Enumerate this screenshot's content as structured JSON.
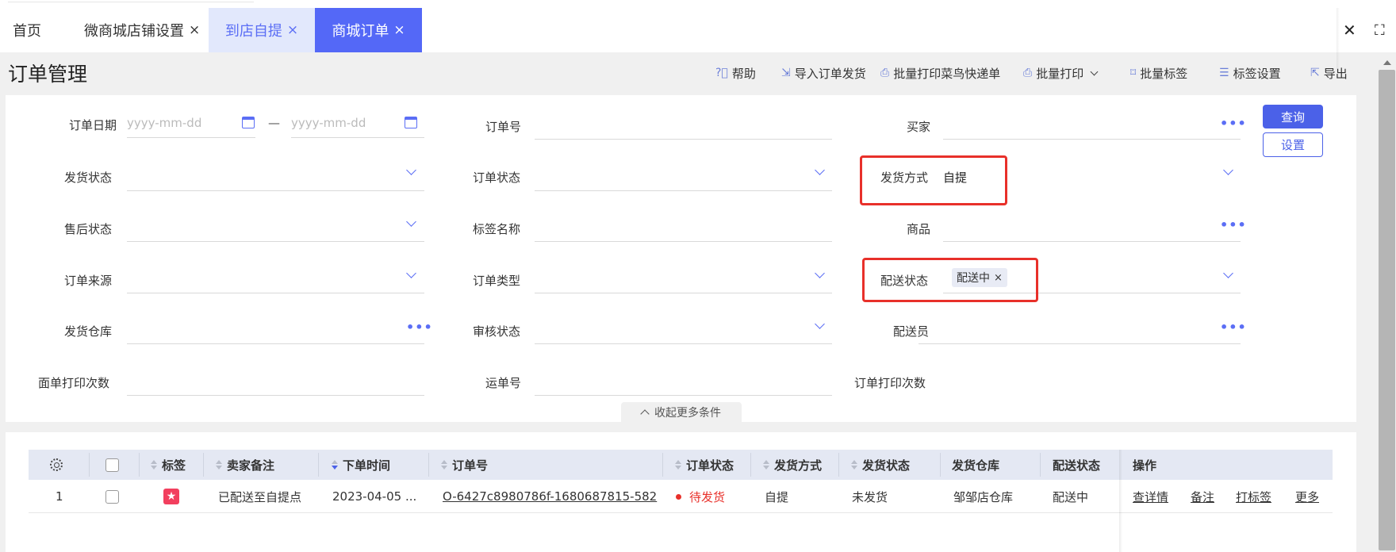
{
  "tabs": {
    "home": "首页",
    "shop_settings": "微商城店铺设置",
    "pickup": "到店自提",
    "mall_orders": "商城订单",
    "close": "×"
  },
  "window": {
    "close": "✕",
    "maximize": "⛶"
  },
  "page": {
    "title": "订单管理"
  },
  "toolbar": {
    "help": "帮助",
    "import_ship": "导入订单发货",
    "batch_print_cainiao": "批量打印菜鸟快递单",
    "batch_print": "批量打印",
    "batch_tag": "批量标签",
    "tag_settings": "标签设置",
    "export": "导出"
  },
  "filters": {
    "order_date": {
      "label": "订单日期",
      "start_placeholder": "yyyy-mm-dd",
      "end_placeholder": "yyyy-mm-dd",
      "separator": "—"
    },
    "order_no": {
      "label": "订单号"
    },
    "buyer": {
      "label": "买家"
    },
    "ship_status": {
      "label": "发货状态"
    },
    "order_status": {
      "label": "订单状态"
    },
    "ship_method": {
      "label": "发货方式",
      "value": "自提"
    },
    "after_sale": {
      "label": "售后状态"
    },
    "tag_name": {
      "label": "标签名称"
    },
    "product": {
      "label": "商品"
    },
    "order_source": {
      "label": "订单来源"
    },
    "order_type": {
      "label": "订单类型"
    },
    "delivery_status": {
      "label": "配送状态",
      "tag": "配送中"
    },
    "warehouse": {
      "label": "发货仓库"
    },
    "audit_status": {
      "label": "审核状态"
    },
    "courier": {
      "label": "配送员"
    },
    "waybill_prints": {
      "label": "面单打印次数"
    },
    "tracking_no": {
      "label": "运单号"
    },
    "order_prints": {
      "label": "订单打印次数"
    },
    "more_dots": "•••"
  },
  "buttons": {
    "query": "查询",
    "settings": "设置",
    "collapse": "收起更多条件"
  },
  "table": {
    "headers": {
      "tag": "标签",
      "seller_note": "卖家备注",
      "order_time": "下单时间",
      "order_no": "订单号",
      "order_status": "订单状态",
      "ship_method": "发货方式",
      "ship_status": "发货状态",
      "warehouse": "发货仓库",
      "delivery_status": "配送状态",
      "actions": "操作"
    },
    "rows": [
      {
        "index": "1",
        "tag_icon": "★",
        "seller_note": "已配送至自提点",
        "order_time": "2023-04-05 ...",
        "order_no": "O-6427c8980786f-1680687815-582",
        "order_status": "待发货",
        "ship_method": "自提",
        "ship_status": "未发货",
        "warehouse": "邹邹店仓库",
        "delivery_status": "配送中",
        "actions": {
          "detail": "查详情",
          "note": "备注",
          "tag": "打标签",
          "more": "更多"
        }
      }
    ]
  },
  "colors": {
    "primary": "#4b61e8",
    "active_tab": "#5468f7",
    "highlight_box": "#e8302a",
    "status_pending": "#e8302a",
    "star_tag": "#f23f5e"
  }
}
